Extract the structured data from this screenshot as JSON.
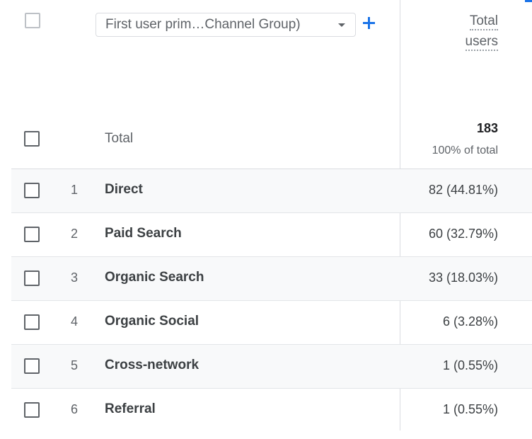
{
  "header": {
    "dimension_select_label": "First user prim…Channel Group)",
    "metric_label_line1": "Total",
    "metric_label_line2": "users"
  },
  "total": {
    "label": "Total",
    "value": "183",
    "percent": "100% of total"
  },
  "rows": [
    {
      "rank": "1",
      "name": "Direct",
      "value": "82 (44.81%)"
    },
    {
      "rank": "2",
      "name": "Paid Search",
      "value": "60 (32.79%)"
    },
    {
      "rank": "3",
      "name": "Organic Search",
      "value": "33 (18.03%)"
    },
    {
      "rank": "4",
      "name": "Organic Social",
      "value": "6 (3.28%)"
    },
    {
      "rank": "5",
      "name": "Cross-network",
      "value": "1 (0.55%)"
    },
    {
      "rank": "6",
      "name": "Referral",
      "value": "1 (0.55%)"
    }
  ],
  "colors": {
    "accent": "#1a73e8",
    "row_shade": "#f8f9fa",
    "divider": "#dadce0"
  }
}
